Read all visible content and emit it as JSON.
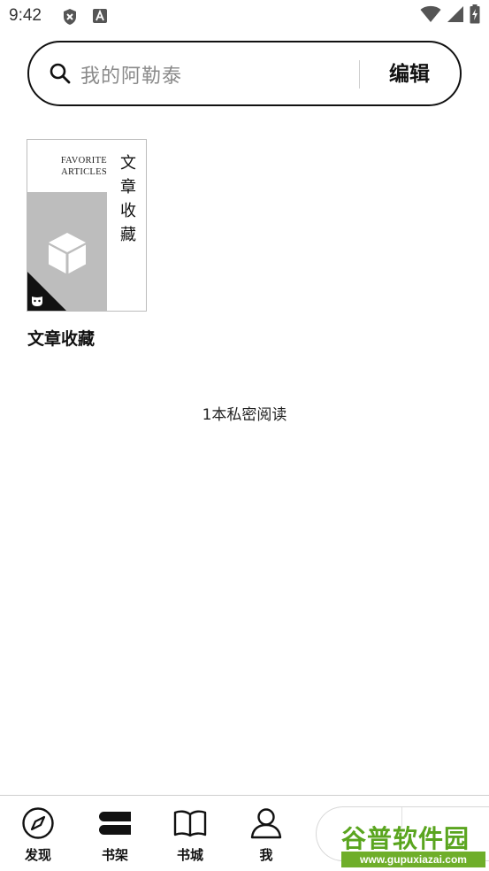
{
  "status_bar": {
    "time": "9:42",
    "left_icons": [
      "shield-x-icon",
      "font-a-icon"
    ],
    "right_icons": [
      "wifi-icon",
      "signal-icon",
      "battery-charging-icon"
    ]
  },
  "search": {
    "placeholder": "我的阿勒泰",
    "edit_label": "编辑"
  },
  "shelf": {
    "books": [
      {
        "title": "文章收藏",
        "cover_en_line1": "FAVORITE",
        "cover_en_line2": "ARTICLES",
        "cover_cn": [
          "文",
          "章",
          "收",
          "藏"
        ]
      }
    ],
    "private_count": "1本私密阅读"
  },
  "bottom_nav": {
    "items": [
      {
        "label": "发现",
        "icon": "compass-icon"
      },
      {
        "label": "书架",
        "icon": "bookshelf-icon"
      },
      {
        "label": "书城",
        "icon": "open-book-icon"
      },
      {
        "label": "我",
        "icon": "person-icon"
      }
    ]
  },
  "watermark": {
    "title": "谷普软件园",
    "url": "www.gupuxiazai.com"
  },
  "colors": {
    "accent": "#111111",
    "cover_gray": "#bdbdbd",
    "watermark_green": "#5aa51f"
  }
}
